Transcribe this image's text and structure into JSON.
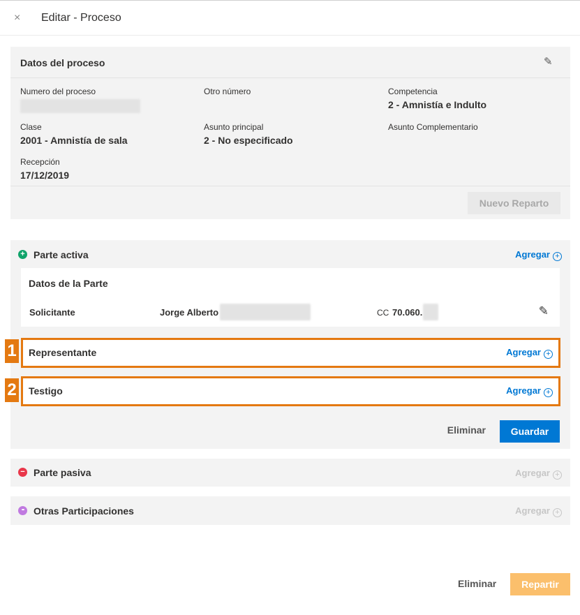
{
  "header": {
    "close_icon": "×",
    "title": "Editar - Proceso"
  },
  "datos": {
    "title": "Datos del proceso",
    "edit_icon": "✎",
    "numero_label": "Numero del proceso",
    "otro_label": "Otro número",
    "competencia_label": "Competencia",
    "competencia_value": "2 - Amnistía e Indulto",
    "clase_label": "Clase",
    "clase_value": "2001 - Amnistía de sala",
    "asunto_label": "Asunto principal",
    "asunto_value": "2 - No especificado",
    "asunto_comp_label": "Asunto Complementario",
    "recepcion_label": "Recepción",
    "recepcion_value": "17/12/2019",
    "nuevo_reparto": "Nuevo Reparto"
  },
  "activa": {
    "title": "Parte activa",
    "icon": "+",
    "agregar": "Agregar",
    "plus": "+",
    "card_title": "Datos de la Parte",
    "rol": "Solicitante",
    "nombre": "Jorge Alberto",
    "doc_type": "CC",
    "doc_number": "70.060.",
    "edit_icon": "✎",
    "representante": "Representante",
    "testigo": "Testigo",
    "badge1": "1",
    "badge2": "2",
    "eliminar": "Eliminar",
    "guardar": "Guardar"
  },
  "pasiva": {
    "title": "Parte pasiva",
    "icon": "−",
    "agregar": "Agregar",
    "plus": "+"
  },
  "otras": {
    "title": "Otras Participaciones",
    "icon": "•••",
    "agregar": "Agregar",
    "plus": "+"
  },
  "footer": {
    "eliminar": "Eliminar",
    "repartir": "Repartir"
  },
  "colors": {
    "accent": "#0078d4",
    "highlight": "#e47911",
    "green": "#10a36a",
    "red": "#e9374a",
    "purple": "#c07ae0"
  }
}
